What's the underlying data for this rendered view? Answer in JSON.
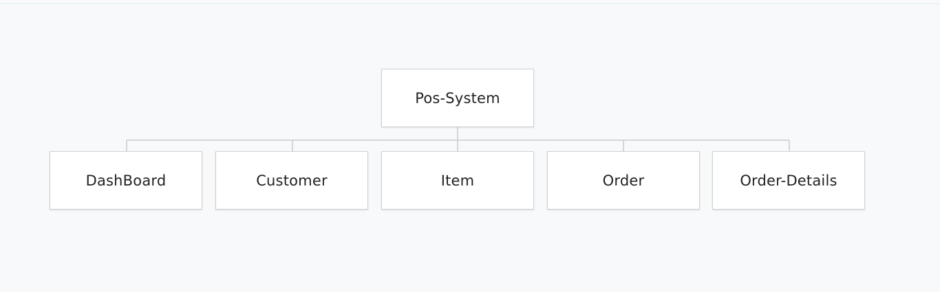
{
  "diagram": {
    "root": {
      "label": "Pos-System"
    },
    "children": [
      {
        "label": "DashBoard"
      },
      {
        "label": "Customer"
      },
      {
        "label": "Item"
      },
      {
        "label": "Order"
      },
      {
        "label": "Order-Details"
      }
    ]
  },
  "colors": {
    "background": "#f8f9fa",
    "node_fill": "#ffffff",
    "node_border": "#cfd2d4",
    "connector": "#c8cbcd",
    "text": "#222222"
  }
}
